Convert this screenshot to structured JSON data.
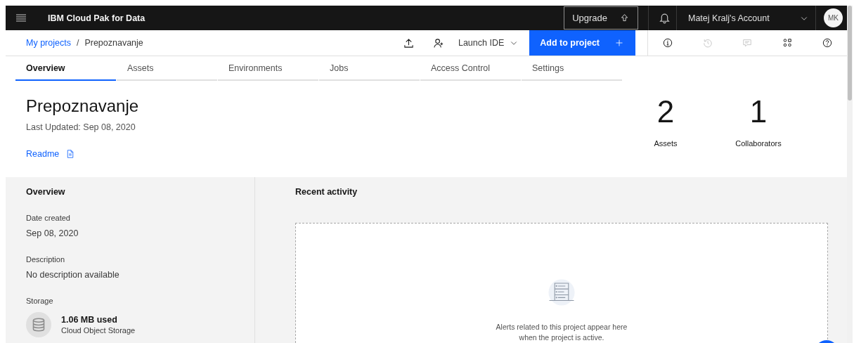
{
  "header": {
    "product": "IBM Cloud Pak for Data",
    "upgrade": "Upgrade",
    "account": "Matej Kralj's Account",
    "avatar": "MK"
  },
  "breadcrumb": {
    "link": "My projects",
    "separator": "/",
    "current": "Prepoznavanje"
  },
  "toolbar": {
    "launch": "Launch IDE",
    "add": "Add to project",
    "icons": [
      {
        "kind": "info",
        "disabled": false
      },
      {
        "kind": "history",
        "disabled": true
      },
      {
        "kind": "comments",
        "disabled": true
      },
      {
        "kind": "assets",
        "disabled": false
      },
      {
        "kind": "help",
        "disabled": false
      }
    ]
  },
  "tabs": [
    {
      "label": "Overview",
      "selected": true
    },
    {
      "label": "Assets",
      "selected": false
    },
    {
      "label": "Environments",
      "selected": false
    },
    {
      "label": "Jobs",
      "selected": false
    },
    {
      "label": "Access Control",
      "selected": false
    },
    {
      "label": "Settings",
      "selected": false
    }
  ],
  "project": {
    "title": "Prepoznavanje",
    "updated": "Last Updated: Sep 08, 2020",
    "readme": "Readme"
  },
  "stats": [
    {
      "value": "2",
      "label": "Assets"
    },
    {
      "value": "1",
      "label": "Collaborators"
    }
  ],
  "overview": {
    "heading": "Overview",
    "fields": [
      {
        "label": "Date created",
        "value": "Sep 08, 2020"
      },
      {
        "label": "Description",
        "value": "No description available"
      }
    ],
    "storage": {
      "label": "Storage",
      "used": "1.06 MB used",
      "service": "Cloud Object Storage"
    }
  },
  "activity": {
    "heading": "Recent activity",
    "empty_message": "Alerts related to this project appear here when the project is active."
  }
}
